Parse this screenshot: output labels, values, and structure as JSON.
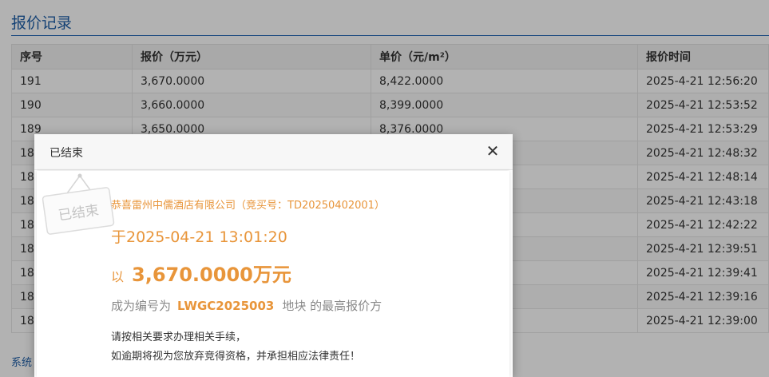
{
  "section_title": "报价记录",
  "table": {
    "headers": [
      "序号",
      "报价（万元）",
      "单价（元/m²）",
      "报价时间"
    ],
    "rows": [
      [
        "191",
        "3,670.0000",
        "8,422.0000",
        "2025-4-21 12:56:20"
      ],
      [
        "190",
        "3,660.0000",
        "8,399.0000",
        "2025-4-21 12:53:52"
      ],
      [
        "189",
        "3,650.0000",
        "8,376.0000",
        "2025-4-21 12:53:29"
      ],
      [
        "18",
        "",
        "",
        "2025-4-21 12:48:32"
      ],
      [
        "18",
        "",
        "",
        "2025-4-21 12:48:14"
      ],
      [
        "18",
        "",
        "",
        "2025-4-21 12:43:18"
      ],
      [
        "18",
        "",
        "",
        "2025-4-21 12:42:22"
      ],
      [
        "18",
        "",
        "",
        "2025-4-21 12:39:51"
      ],
      [
        "18",
        "",
        "",
        "2025-4-21 12:39:41"
      ],
      [
        "18",
        "",
        "",
        "2025-4-21 12:39:16"
      ],
      [
        "18",
        "",
        "",
        "2025-4-21 12:39:00"
      ]
    ]
  },
  "footer_text": "系统",
  "dialog": {
    "title": "已结束",
    "close_glyph": "✕",
    "stamp_text": "已结束",
    "winner": "恭喜雷州中儒酒店有限公司（竞买号：TD20250402001）",
    "time_line": "于2025-04-21 13:01:20",
    "price_prefix": "以",
    "price_value": "3,670.0000万元",
    "lot_prefix": "成为编号为",
    "lot_id": "LWGC2025003",
    "lot_suffix": "地块 的最高报价方",
    "note1": "请按相关要求办理相关手续，",
    "note2": "如逾期将视为您放弃竞得资格，并承担相应法律责任！"
  },
  "colors": {
    "accent_blue": "#1f5fa8",
    "accent_orange": "#e8953a"
  }
}
